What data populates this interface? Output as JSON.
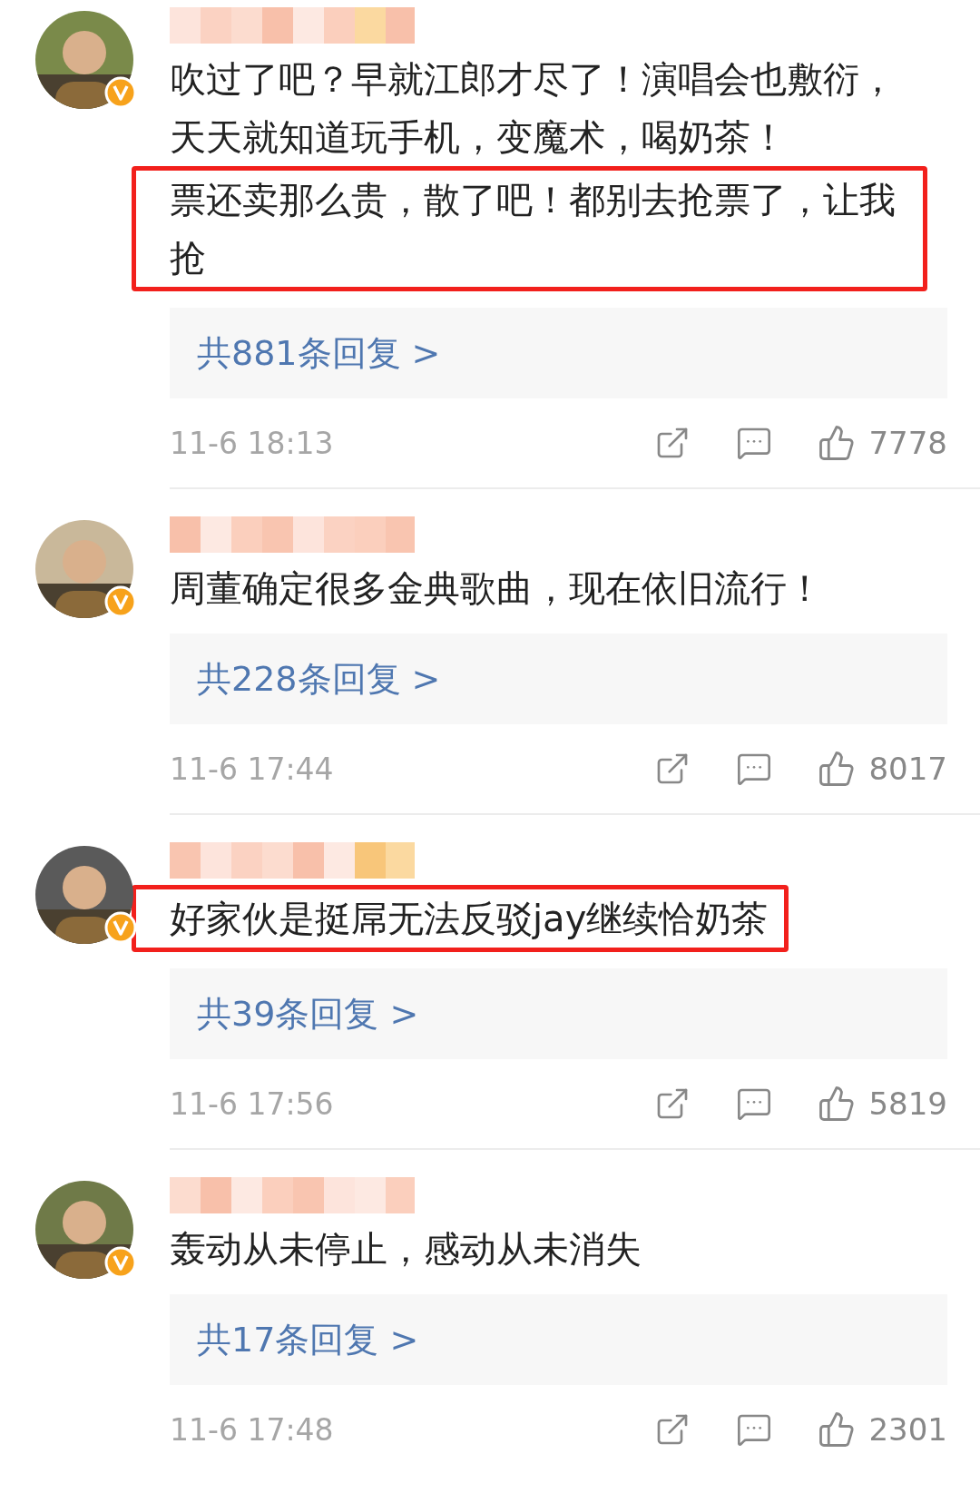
{
  "comments": [
    {
      "verified": true,
      "segments": [
        {
          "text": "吹过了吧？早就江郎才尽了！演唱会也敷衍，天天就知道玩手机，变魔术，喝奶茶！",
          "highlighted": false
        },
        {
          "text": "票还卖那么贵，散了吧！都别去抢票了，让我抢",
          "highlighted": true
        }
      ],
      "replies": "共881条回复 >",
      "time": "11-6 18:13",
      "likes": "7778"
    },
    {
      "verified": true,
      "segments": [
        {
          "text": "周董确定很多金典歌曲，现在依旧流行！",
          "highlighted": false
        }
      ],
      "replies": "共228条回复 >",
      "time": "11-6 17:44",
      "likes": "8017"
    },
    {
      "verified": true,
      "segments": [
        {
          "text": "好家伙是挺屌无法反驳jay继续恰奶茶",
          "highlighted": true
        }
      ],
      "replies": "共39条回复 >",
      "time": "11-6 17:56",
      "likes": "5819"
    },
    {
      "verified": true,
      "segments": [
        {
          "text": "轰动从未停止，感动从未消失",
          "highlighted": false
        }
      ],
      "replies": "共17条回复 >",
      "time": "11-6 17:48",
      "likes": "2301"
    }
  ]
}
